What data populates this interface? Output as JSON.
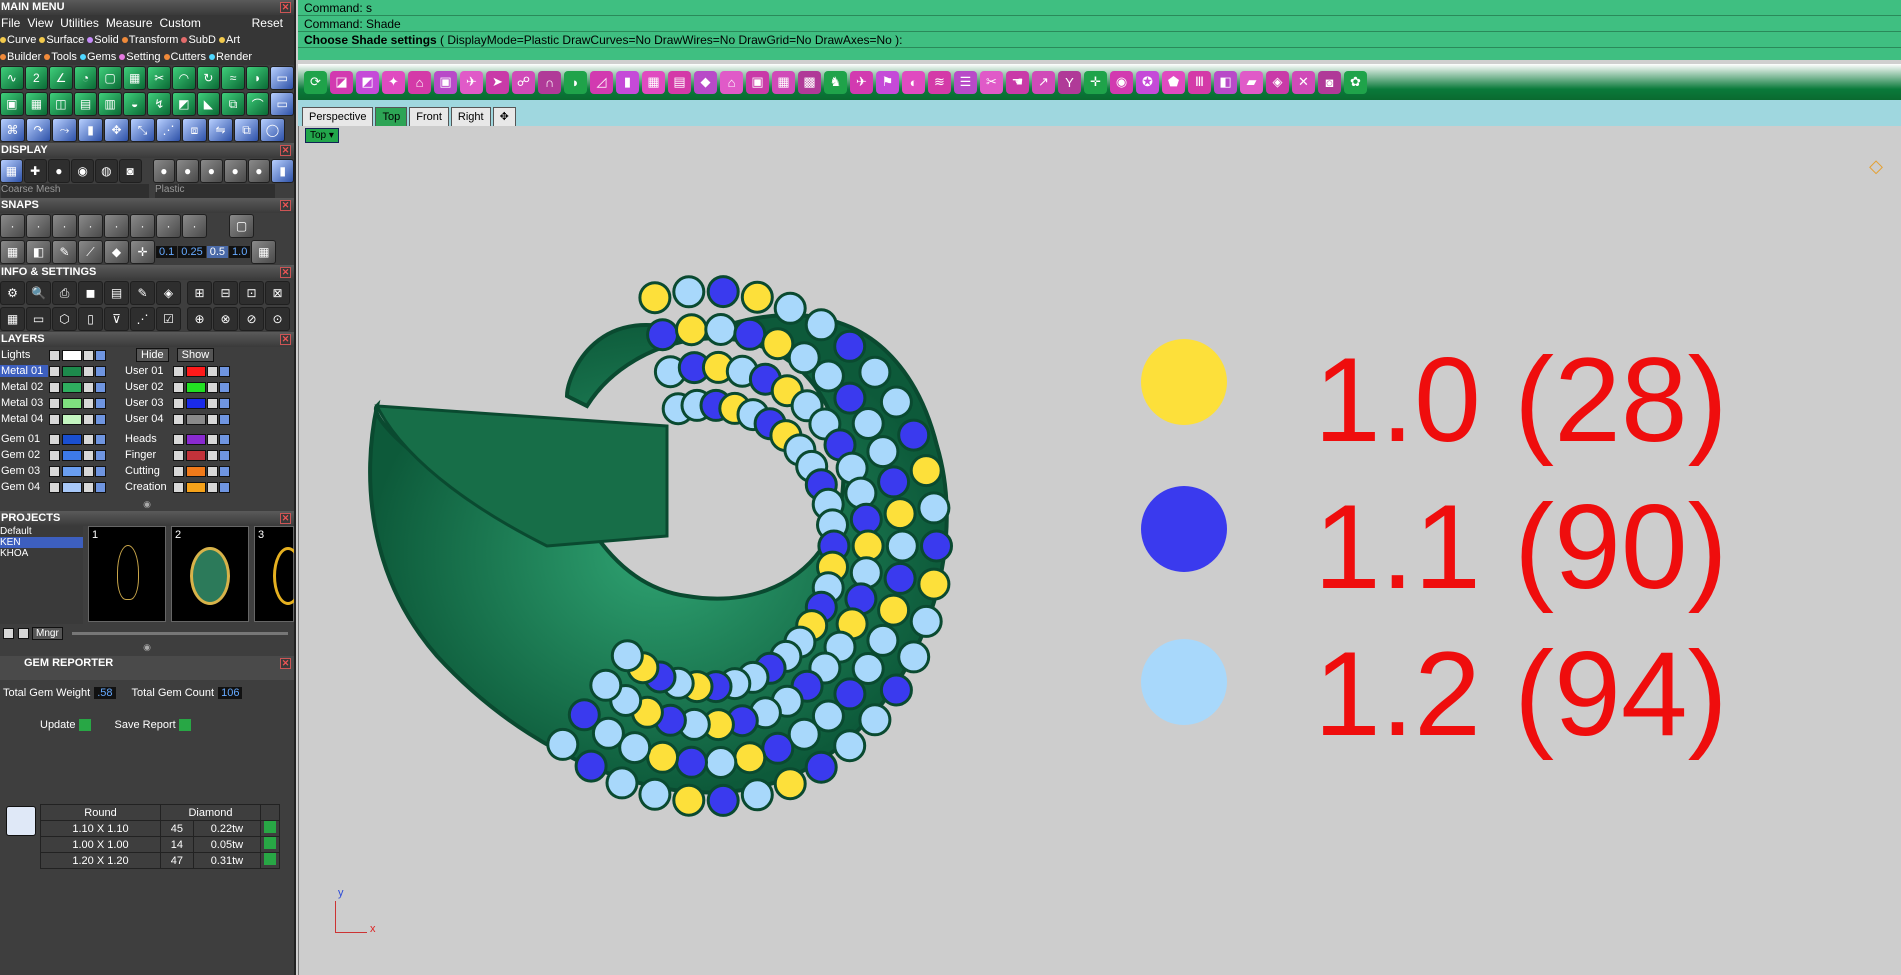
{
  "main_menu": {
    "title": "MAIN MENU",
    "menus": [
      "File",
      "View",
      "Utilities",
      "Measure",
      "Custom"
    ],
    "reset": "Reset",
    "categories_row1": [
      {
        "label": "Curve",
        "color": "#f2c94c"
      },
      {
        "label": "Surface",
        "color": "#f2c94c"
      },
      {
        "label": "Solid",
        "color": "#c58af9"
      },
      {
        "label": "Transform",
        "color": "#f08a3a"
      },
      {
        "label": "SubD",
        "color": "#e36b6b"
      },
      {
        "label": "Art",
        "color": "#f2c94c"
      }
    ],
    "categories_row2": [
      {
        "label": "Builder",
        "color": "#f08a3a"
      },
      {
        "label": "Tools",
        "color": "#f08a3a"
      },
      {
        "label": "Gems",
        "color": "#4fd6ff"
      },
      {
        "label": "Setting",
        "color": "#e57ae0"
      },
      {
        "label": "Cutters",
        "color": "#f08a3a"
      },
      {
        "label": "Render",
        "color": "#4fd6ff"
      }
    ]
  },
  "display": {
    "title": "DISPLAY",
    "mesh": "Coarse Mesh",
    "material": "Plastic"
  },
  "snaps": {
    "title": "SNAPS",
    "values": [
      "0.1",
      "0.25",
      "0.5",
      "1.0"
    ]
  },
  "info": {
    "title": "INFO & SETTINGS"
  },
  "layers": {
    "title": "LAYERS",
    "lights": "Lights",
    "hide": "Hide",
    "show": "Show",
    "metal": [
      {
        "name": "Metal 01",
        "color": "#1d8a4c"
      },
      {
        "name": "Metal 02",
        "color": "#2fae5f"
      },
      {
        "name": "Metal 03",
        "color": "#7fe07f"
      },
      {
        "name": "Metal 04",
        "color": "#c4f5c0"
      }
    ],
    "user": [
      {
        "name": "User 01",
        "color": "#ff1a1a"
      },
      {
        "name": "User 02",
        "color": "#22e022"
      },
      {
        "name": "User 03",
        "color": "#1a2ae8"
      },
      {
        "name": "User 04",
        "color": "#8a8a8a"
      }
    ],
    "gem": [
      {
        "name": "Gem 01",
        "color": "#1a4fd0"
      },
      {
        "name": "Gem 02",
        "color": "#3d7ae8"
      },
      {
        "name": "Gem 03",
        "color": "#6a9ef0"
      },
      {
        "name": "Gem 04",
        "color": "#a8c8f8"
      }
    ],
    "other": [
      {
        "name": "Heads",
        "color": "#8a2ad0"
      },
      {
        "name": "Finger",
        "color": "#c2323a"
      },
      {
        "name": "Cutting",
        "color": "#f07a1a"
      },
      {
        "name": "Creation",
        "color": "#f5a21a"
      }
    ]
  },
  "projects": {
    "title": "PROJECTS",
    "items": [
      "Default",
      "KEN",
      "KHOA"
    ],
    "thumbs": [
      "1",
      "2",
      "3"
    ],
    "mngr": "Mngr"
  },
  "gem_reporter": {
    "title": "GEM REPORTER",
    "total_weight_label": "Total Gem Weight",
    "total_weight": ".58",
    "total_count_label": "Total Gem Count",
    "total_count": "106",
    "update": "Update",
    "save_report": "Save Report",
    "col_shape": "Round",
    "col_cut": "Diamond",
    "rows": [
      {
        "size": "1.10 X 1.10",
        "count": "45",
        "weight": "0.22tw"
      },
      {
        "size": "1.00 X 1.00",
        "count": "14",
        "weight": "0.05tw"
      },
      {
        "size": "1.20 X 1.20",
        "count": "47",
        "weight": "0.31tw"
      }
    ]
  },
  "command": {
    "line1": "Command: s",
    "line2": "Command: Shade",
    "prompt": "Choose Shade settings",
    "options": "( DisplayMode=Plastic  DrawCurves=No  DrawWires=No  DrawGrid=No  DrawAxes=No ):"
  },
  "tabs": [
    "Perspective",
    "Top",
    "Front",
    "Right"
  ],
  "viewport_label": "Top",
  "legend": [
    {
      "color": "#fde03a",
      "text": "1.0 (28)"
    },
    {
      "color": "#3a3aee",
      "text": "1.1 (90)"
    },
    {
      "color": "#a8d8fb",
      "text": "1.2 (94)"
    }
  ],
  "axes": {
    "y": "y",
    "x": "x"
  }
}
